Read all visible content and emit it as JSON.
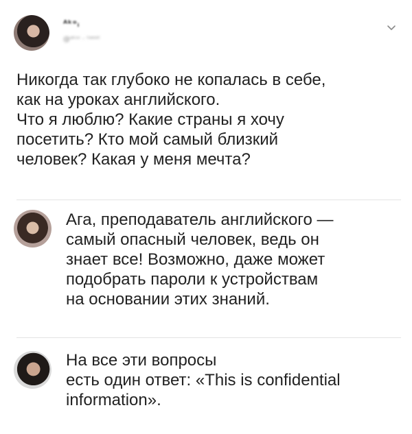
{
  "tweet": {
    "author_name": "ᴬᵏᵒᵢ",
    "author_handle": "@ᵃᵏᵒᶦ · ᵗʷᵉᵉᵗ",
    "text": "Никогда так глубоко не копалась в себе,\nкак на уроках английского.\nЧто я люблю? Какие страны я хочу\nпосетить? Кто мой самый близкий\nчеловек? Какая у меня мечта?"
  },
  "replies": [
    {
      "text": "Ага, преподаватель английского —\nсамый опасный человек, ведь он\nзнает все! Возможно, даже может\nподобрать пароли к устройствам\nна основании этих знаний."
    },
    {
      "text": "На все эти вопросы\nесть один ответ: «This is confidential\ninformation»."
    }
  ],
  "icons": {
    "chevron": "chevron-down-icon"
  }
}
